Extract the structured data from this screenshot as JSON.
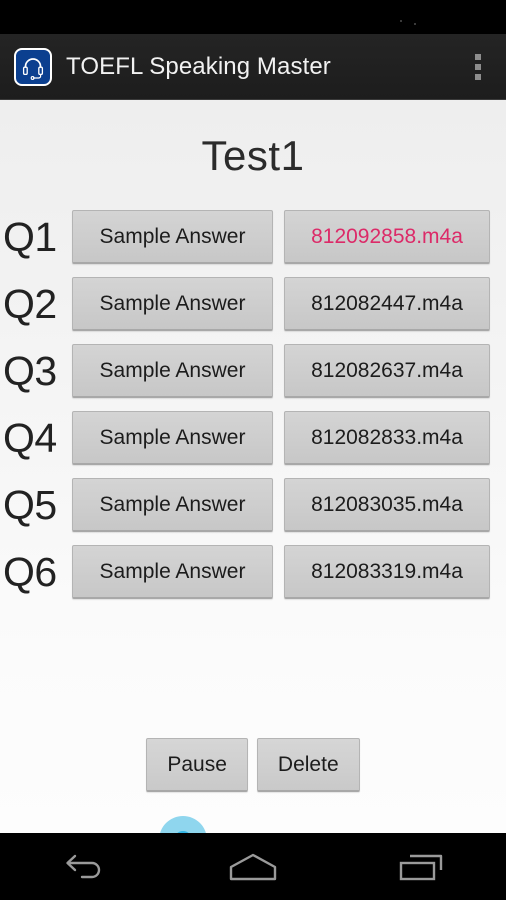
{
  "status_bar": {
    "dots": 2
  },
  "action_bar": {
    "title": "TOEFL Speaking Master",
    "icon": "headset-icon",
    "overflow": "overflow-menu-icon"
  },
  "page": {
    "title": "Test1"
  },
  "questions": [
    {
      "label": "Q1",
      "sample_label": "Sample Answer",
      "file": "812092858.m4a",
      "active": true
    },
    {
      "label": "Q2",
      "sample_label": "Sample Answer",
      "file": "812082447.m4a",
      "active": false
    },
    {
      "label": "Q3",
      "sample_label": "Sample Answer",
      "file": "812082637.m4a",
      "active": false
    },
    {
      "label": "Q4",
      "sample_label": "Sample Answer",
      "file": "812082833.m4a",
      "active": false
    },
    {
      "label": "Q5",
      "sample_label": "Sample Answer",
      "file": "812083035.m4a",
      "active": false
    },
    {
      "label": "Q6",
      "sample_label": "Sample Answer",
      "file": "812083319.m4a",
      "active": false
    }
  ],
  "transport": {
    "pause_label": "Pause",
    "delete_label": "Delete"
  },
  "seekbar": {
    "progress_percent": 35,
    "fill_color": "#2eaadc",
    "thumb_color": "#33b5e5",
    "halo_color": "#8fd6ee",
    "track_color": "#c9c9c9"
  },
  "nav_bar": {
    "back": "back-icon",
    "home": "home-icon",
    "recents": "recents-icon"
  },
  "colors": {
    "active_file_text": "#dc2a68",
    "app_icon_bg": "#0b3f8f",
    "action_bar_bg": "#1f1f1f",
    "content_bg": "#f3f3f3"
  }
}
